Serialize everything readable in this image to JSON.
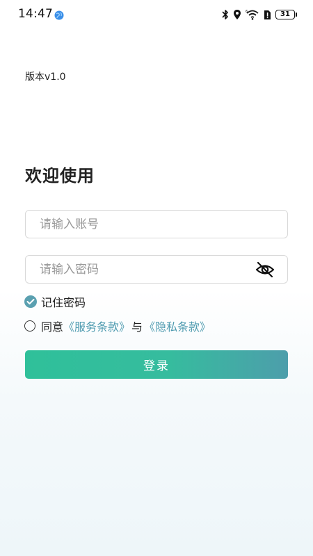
{
  "status_bar": {
    "time": "14:47",
    "battery_level": "31",
    "icons": [
      "globe-icon",
      "bluetooth-icon",
      "location-icon",
      "wifi-icon",
      "sim-alert-icon",
      "battery-icon"
    ]
  },
  "version": "版本v1.0",
  "welcome_title": "欢迎使用",
  "account_input": {
    "placeholder": "请输入账号",
    "value": ""
  },
  "password_input": {
    "placeholder": "请输入密码",
    "value": "",
    "toggle_icon": "eye-off-icon"
  },
  "remember": {
    "label": "记住密码",
    "checked": true
  },
  "agreement": {
    "prefix": "同意",
    "terms_link": "《服务条款》",
    "conjunction": "与",
    "privacy_link": "《隐私条款》",
    "checked": false
  },
  "login_button": {
    "label": "登录"
  },
  "colors": {
    "accent": "#5aa0b0",
    "link": "#4f9bb0",
    "button_start": "#2fc09a",
    "button_end": "#4d9eab"
  }
}
